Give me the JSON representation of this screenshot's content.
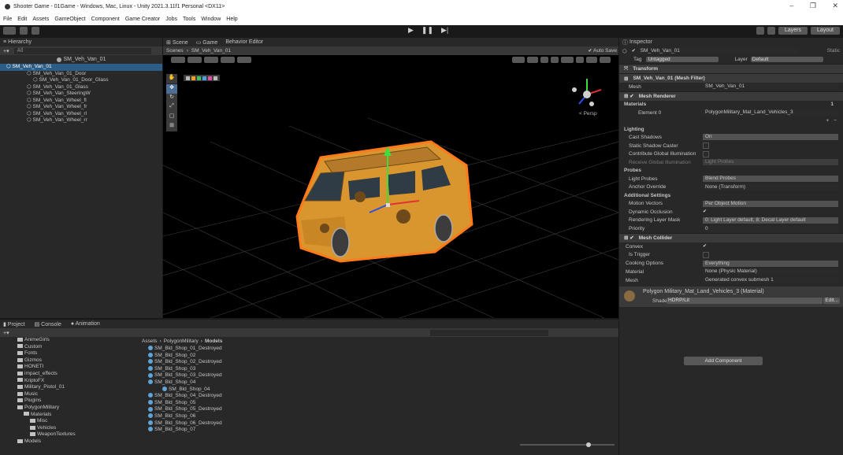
{
  "window": {
    "title": "Shooter Game - 01Game - Windows, Mac, Linux - Unity 2021.3.11f1 Personal <DX11>"
  },
  "menu": [
    "File",
    "Edit",
    "Assets",
    "GameObject",
    "Component",
    "Game Creator",
    "Jobs",
    "Tools",
    "Window",
    "Help"
  ],
  "toolbar": {
    "layers_label": "Layers",
    "layout_label": "Layout"
  },
  "hierarchy": {
    "tab": "Hierarchy",
    "search_placeholder": "All",
    "scene_label": "SM_Veh_Van_01",
    "items": [
      {
        "label": "SM_Veh_Van_01",
        "selected": true
      },
      {
        "label": "SM_Veh_Van_01_Door"
      },
      {
        "label": "SM_Veh_Van_01_Door_Glass"
      },
      {
        "label": "SM_Veh_Van_01_Glass"
      },
      {
        "label": "SM_Veh_Van_SteeringW"
      },
      {
        "label": "SM_Veh_Van_Wheel_fl"
      },
      {
        "label": "SM_Veh_Van_Wheel_fr"
      },
      {
        "label": "SM_Veh_Van_Wheel_rl"
      },
      {
        "label": "SM_Veh_Van_Wheel_rr"
      }
    ]
  },
  "scene_tabs": {
    "scene": "Scene",
    "game": "Game",
    "behavior": "Behavior Editor"
  },
  "scene_bar": {
    "breadcrumb_root": "Scenes",
    "breadcrumb_current": "SM_Veh_Van_01",
    "autosave": "Auto Save"
  },
  "scene_view": {
    "persp": "< Persp"
  },
  "inspector": {
    "tab": "Inspector",
    "object_name": "SM_Veh_Van_01",
    "static_label": "Static",
    "tag_label": "Tag",
    "tag_value": "Untagged",
    "layer_label": "Layer",
    "layer_value": "Default",
    "transform": "Transform",
    "mesh_filter": "SM_Veh_Van_01 (Mesh Filter)",
    "mesh_label": "Mesh",
    "mesh_value": "SM_Veh_Van_01",
    "mesh_renderer": "Mesh Renderer",
    "materials_label": "Materials",
    "materials_count": "1",
    "element0_label": "Element 0",
    "element0_value": "PolygonMilitary_Mat_Land_Vehicles_3",
    "lighting_label": "Lighting",
    "cast_shadows_label": "Cast Shadows",
    "cast_shadows_value": "On",
    "static_shadow_label": "Static Shadow Caster",
    "contribute_gi_label": "Contribute Global Illumination",
    "receive_gi_label": "Receive Global Illumination",
    "receive_gi_value": "Light Probes",
    "probes_label": "Probes",
    "light_probes_label": "Light Probes",
    "light_probes_value": "Blend Probes",
    "anchor_label": "Anchor Override",
    "anchor_value": "None (Transform)",
    "additional_label": "Additional Settings",
    "motion_label": "Motion Vectors",
    "motion_value": "Per Object Motion",
    "occlusion_label": "Dynamic Occlusion",
    "rendering_layer_label": "Rendering Layer Mask",
    "rendering_layer_value": "0: Light Layer default, 8: Decal Layer default",
    "priority_label": "Priority",
    "priority_value": "0",
    "mesh_collider": "Mesh Collider",
    "convex_label": "Convex",
    "is_trigger_label": "Is Trigger",
    "cooking_label": "Cooking Options",
    "cooking_value": "Everything",
    "material_label": "Material",
    "material_value": "None (Physic Material)",
    "collider_mesh_label": "Mesh",
    "collider_mesh_value": "Generated convex submesh 1",
    "material_asset": "Polygon Military_Mat_Land_Vehicles_3 (Material)",
    "shader_label": "Shader",
    "shader_value": "HDRP/Lit",
    "edit_label": "Edit...",
    "add_component": "Add Component"
  },
  "project": {
    "tabs": [
      "Project",
      "Console",
      "Animation"
    ],
    "path_root": "Assets",
    "path_mid": "PolygonMilitary",
    "path_current": "Models",
    "folders": [
      {
        "label": "AnimeGirls"
      },
      {
        "label": "Custom"
      },
      {
        "label": "Fonts"
      },
      {
        "label": "Gizmos"
      },
      {
        "label": "HONETI"
      },
      {
        "label": "impact_effects"
      },
      {
        "label": "KriptoFX"
      },
      {
        "label": "Military_Pistol_01"
      },
      {
        "label": "Music"
      },
      {
        "label": "Plugins"
      },
      {
        "label": "PolygonMilitary"
      },
      {
        "label": "Materials"
      },
      {
        "label": "Misc"
      },
      {
        "label": "Vehicles"
      },
      {
        "label": "WeaponTextures"
      },
      {
        "label": "Models"
      }
    ],
    "assets": [
      {
        "label": "SM_Bld_Shop_01_Destroyed"
      },
      {
        "label": "SM_Bld_Shop_02"
      },
      {
        "label": "SM_Bld_Shop_02_Destroyed"
      },
      {
        "label": "SM_Bld_Shop_03"
      },
      {
        "label": "SM_Bld_Shop_03_Destroyed"
      },
      {
        "label": "SM_Bld_Shop_04"
      },
      {
        "label": "SM_Bld_Shop_04"
      },
      {
        "label": "SM_Bld_Shop_04_Destroyed"
      },
      {
        "label": "SM_Bld_Shop_05"
      },
      {
        "label": "SM_Bld_Shop_05_Destroyed"
      },
      {
        "label": "SM_Bld_Shop_06"
      },
      {
        "label": "SM_Bld_Shop_06_Destroyed"
      },
      {
        "label": "SM_Bld_Shop_07"
      }
    ]
  },
  "colors": {
    "selection": "#2c5d87",
    "van_body": "#d9962f",
    "outline": "#ff7a1a",
    "panel": "#282828"
  }
}
